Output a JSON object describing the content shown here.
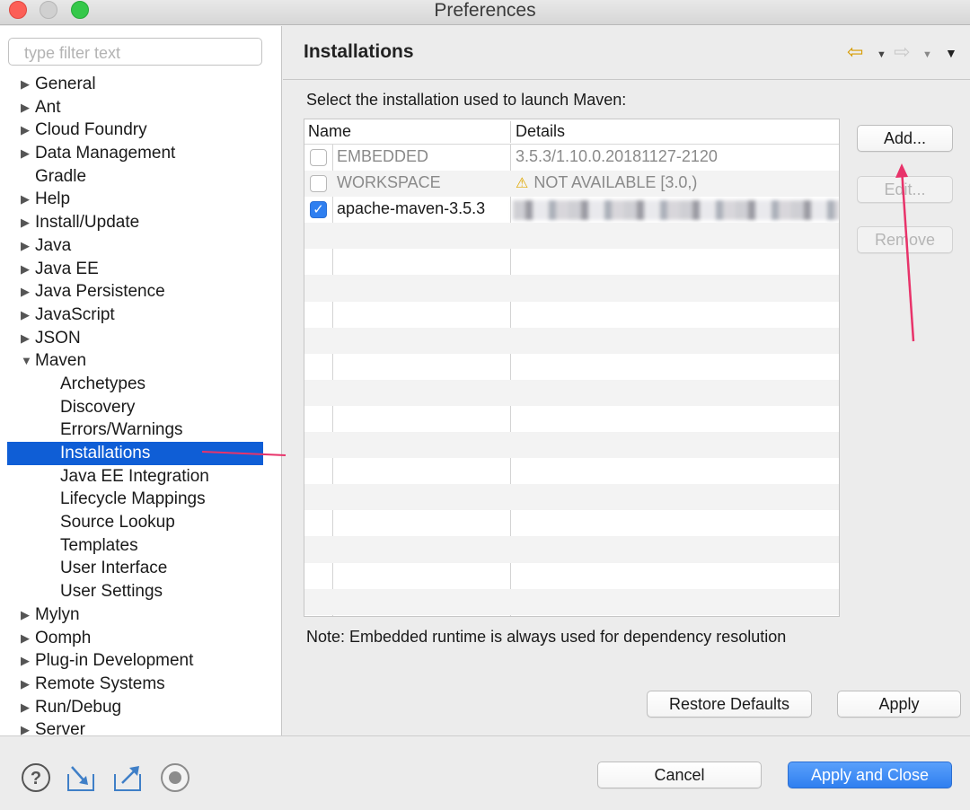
{
  "window": {
    "title": "Preferences"
  },
  "sidebar": {
    "filter_placeholder": "type filter text",
    "items": [
      {
        "label": "General",
        "expandable": true
      },
      {
        "label": "Ant",
        "expandable": true
      },
      {
        "label": "Cloud Foundry",
        "expandable": true
      },
      {
        "label": "Data Management",
        "expandable": true
      },
      {
        "label": "Gradle",
        "expandable": false
      },
      {
        "label": "Help",
        "expandable": true
      },
      {
        "label": "Install/Update",
        "expandable": true
      },
      {
        "label": "Java",
        "expandable": true
      },
      {
        "label": "Java EE",
        "expandable": true
      },
      {
        "label": "Java Persistence",
        "expandable": true
      },
      {
        "label": "JavaScript",
        "expandable": true
      },
      {
        "label": "JSON",
        "expandable": true
      },
      {
        "label": "Maven",
        "expandable": true,
        "expanded": true
      },
      {
        "label": "Archetypes",
        "child": true
      },
      {
        "label": "Discovery",
        "child": true
      },
      {
        "label": "Errors/Warnings",
        "child": true
      },
      {
        "label": "Installations",
        "child": true,
        "selected": true
      },
      {
        "label": "Java EE Integration",
        "child": true
      },
      {
        "label": "Lifecycle Mappings",
        "child": true
      },
      {
        "label": "Source Lookup",
        "child": true
      },
      {
        "label": "Templates",
        "child": true
      },
      {
        "label": "User Interface",
        "child": true
      },
      {
        "label": "User Settings",
        "child": true
      },
      {
        "label": "Mylyn",
        "expandable": true
      },
      {
        "label": "Oomph",
        "expandable": true
      },
      {
        "label": "Plug-in Development",
        "expandable": true
      },
      {
        "label": "Remote Systems",
        "expandable": true
      },
      {
        "label": "Run/Debug",
        "expandable": true
      },
      {
        "label": "Server",
        "expandable": true
      }
    ]
  },
  "main": {
    "title": "Installations",
    "instruction": "Select the installation used to launch Maven:",
    "table": {
      "columns": [
        "Name",
        "Details"
      ],
      "rows": [
        {
          "checked": false,
          "name": "EMBEDDED",
          "details": "3.5.3/1.10.0.20181127-2120",
          "muted": true
        },
        {
          "checked": false,
          "name": "WORKSPACE",
          "details": "NOT AVAILABLE [3.0,)",
          "muted": true,
          "warning": true
        },
        {
          "checked": true,
          "name": "apache-maven-3.5.3",
          "details": "",
          "redacted": true
        }
      ]
    },
    "buttons": {
      "add": "Add...",
      "edit": "Edit...",
      "remove": "Remove"
    },
    "note": "Note: Embedded runtime is always used for dependency resolution",
    "restore_defaults": "Restore Defaults",
    "apply": "Apply"
  },
  "footer": {
    "cancel": "Cancel",
    "apply_and_close": "Apply and Close",
    "icons": [
      "help-icon",
      "import-icon",
      "export-icon",
      "record-icon"
    ]
  },
  "colors": {
    "selection": "#0f5ed6",
    "accent_button": "#2f7ff0",
    "annotation": "#e8336a"
  }
}
